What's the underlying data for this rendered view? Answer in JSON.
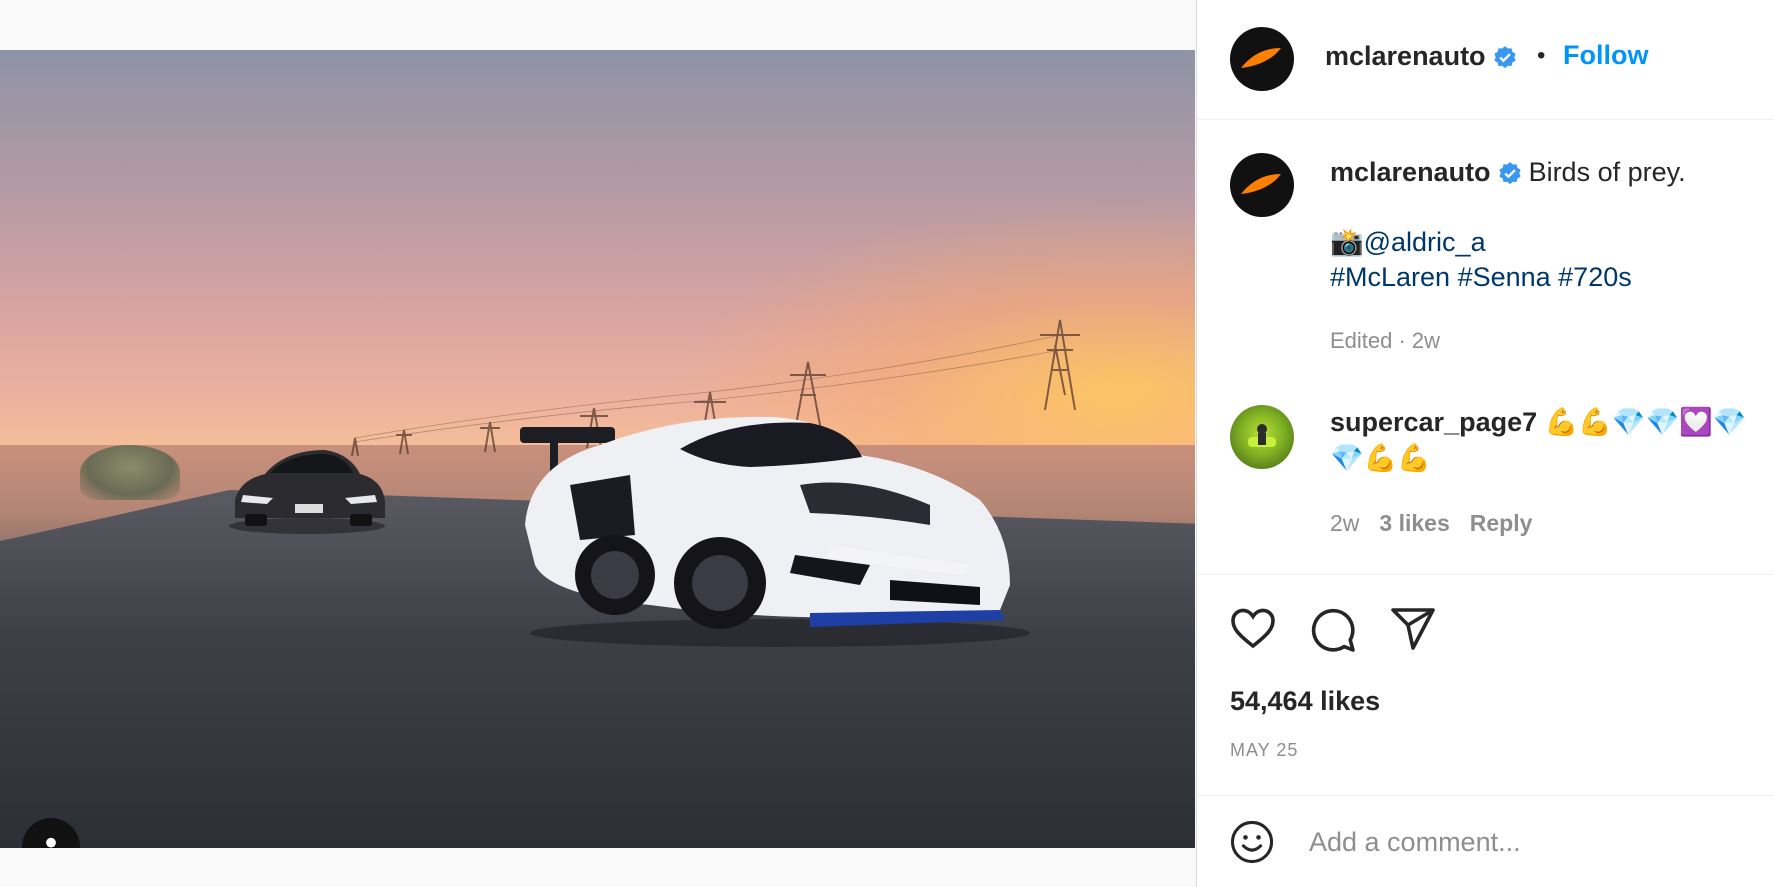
{
  "post": {
    "author": "mclarenauto",
    "follow_label": "Follow",
    "separator": "•"
  },
  "caption": {
    "author": "mclarenauto",
    "text": "Birds of prey.",
    "credit": "📸@aldric_a",
    "hashtags": "#McLaren #Senna #720s",
    "meta": "Edited · 2w"
  },
  "comment": {
    "author": "supercar_page7",
    "text": "💪💪💎💎💟💎💎💪💪",
    "time": "2w",
    "likes": "3 likes",
    "reply": "Reply"
  },
  "actions": {
    "likes_count": "54,464 likes",
    "date": "MAY 25"
  },
  "comment_box": {
    "placeholder": "Add a comment..."
  },
  "colors": {
    "link": "#0095f6",
    "hashtag": "#00376b",
    "muted": "#8e8e8e",
    "verified": "#3897f0",
    "mclaren_orange": "#ff8000"
  },
  "icons": [
    "user-tag-icon",
    "verified-icon",
    "heart-icon",
    "comment-icon",
    "share-icon",
    "emoji-icon",
    "mclaren-logo-icon"
  ]
}
